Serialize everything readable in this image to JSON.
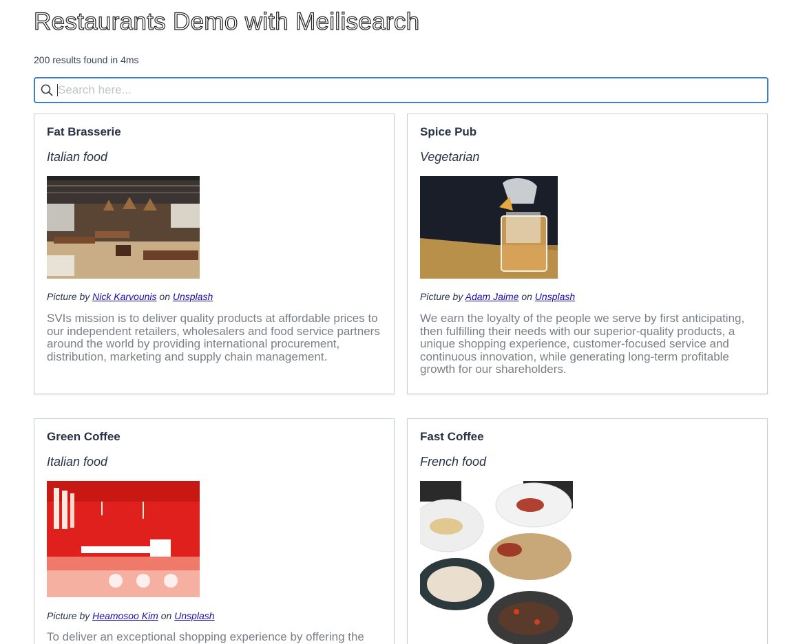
{
  "header": {
    "title": "Restaurants Demo with Meilisearch",
    "results_count": "200 results found in 4ms"
  },
  "search": {
    "placeholder": "Search here...",
    "value": ""
  },
  "hits": [
    {
      "name": "Fat Brasserie",
      "type": "Italian food",
      "credit_prefix": "Picture by",
      "photographer": "Nick Karvounis",
      "credit_on": "on",
      "source": "Unsplash",
      "description": "SVIs mission is to deliver quality products at affordable prices to our independent retailers, wholesalers and food service partners around the world by providing international procurement, distribution, marketing and supply chain management."
    },
    {
      "name": "Spice Pub",
      "type": "Vegetarian",
      "credit_prefix": "Picture by",
      "photographer": "Adam Jaime",
      "credit_on": "on",
      "source": "Unsplash",
      "description": "We earn the loyalty of the people we serve by first anticipating, then fulfilling their needs with our superior-quality products, a unique shopping experience, customer-focused service and continuous innovation, while generating long-term profitable growth for our shareholders."
    },
    {
      "name": "Green Coffee",
      "type": "Italian food",
      "credit_prefix": "Picture by",
      "photographer": "Heamosoo Kim",
      "credit_on": "on",
      "source": "Unsplash",
      "description": "To deliver an exceptional shopping experience by offering the"
    },
    {
      "name": "Fast Coffee",
      "type": "French food",
      "credit_prefix": "",
      "photographer": "",
      "credit_on": "",
      "source": "",
      "description": ""
    }
  ],
  "colors": {
    "accent": "#3d7cc8",
    "link": "#1a0dab",
    "card_border": "#c9ced6",
    "description_text": "#7b7f86"
  },
  "icons": {
    "search": "search-icon"
  }
}
